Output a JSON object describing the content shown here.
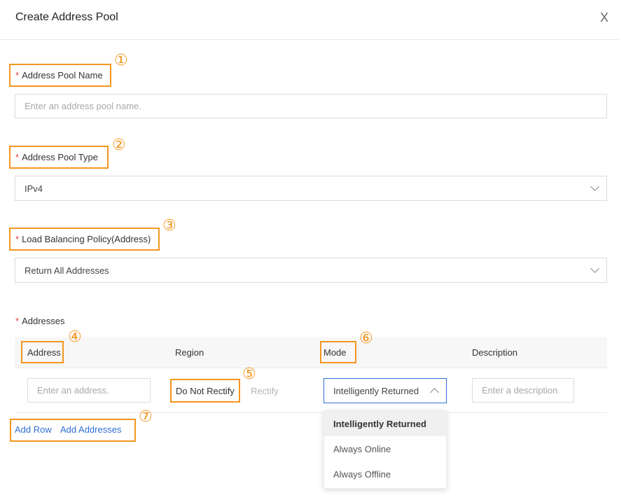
{
  "dialog": {
    "title": "Create Address Pool",
    "close_label": "X"
  },
  "annotations": [
    "①",
    "②",
    "③",
    "④",
    "⑤",
    "⑥",
    "⑦"
  ],
  "form": {
    "pool_name": {
      "label": "Address Pool Name",
      "placeholder": "Enter an address pool name."
    },
    "pool_type": {
      "label": "Address Pool Type",
      "value": "IPv4"
    },
    "lb_policy": {
      "label": "Load Balancing Policy(Address)",
      "value": "Return All Addresses"
    },
    "addresses": {
      "label": "Addresses",
      "columns": [
        "Address",
        "Region",
        "Mode",
        "Description"
      ],
      "row": {
        "address_placeholder": "Enter an address.",
        "region_options": [
          "Do Not Rectify",
          "Rectify"
        ],
        "mode_value": "Intelligently Returned",
        "description_placeholder": "Enter a description"
      },
      "mode_options": [
        "Intelligently Returned",
        "Always Online",
        "Always Offline"
      ]
    },
    "actions": {
      "add_row": "Add Row",
      "add_addresses": "Add Addresses"
    }
  },
  "colors": {
    "annotation": "#f5961f",
    "required": "#e53935",
    "link": "#2f6fd8",
    "focus_border": "#2f6fd8"
  }
}
